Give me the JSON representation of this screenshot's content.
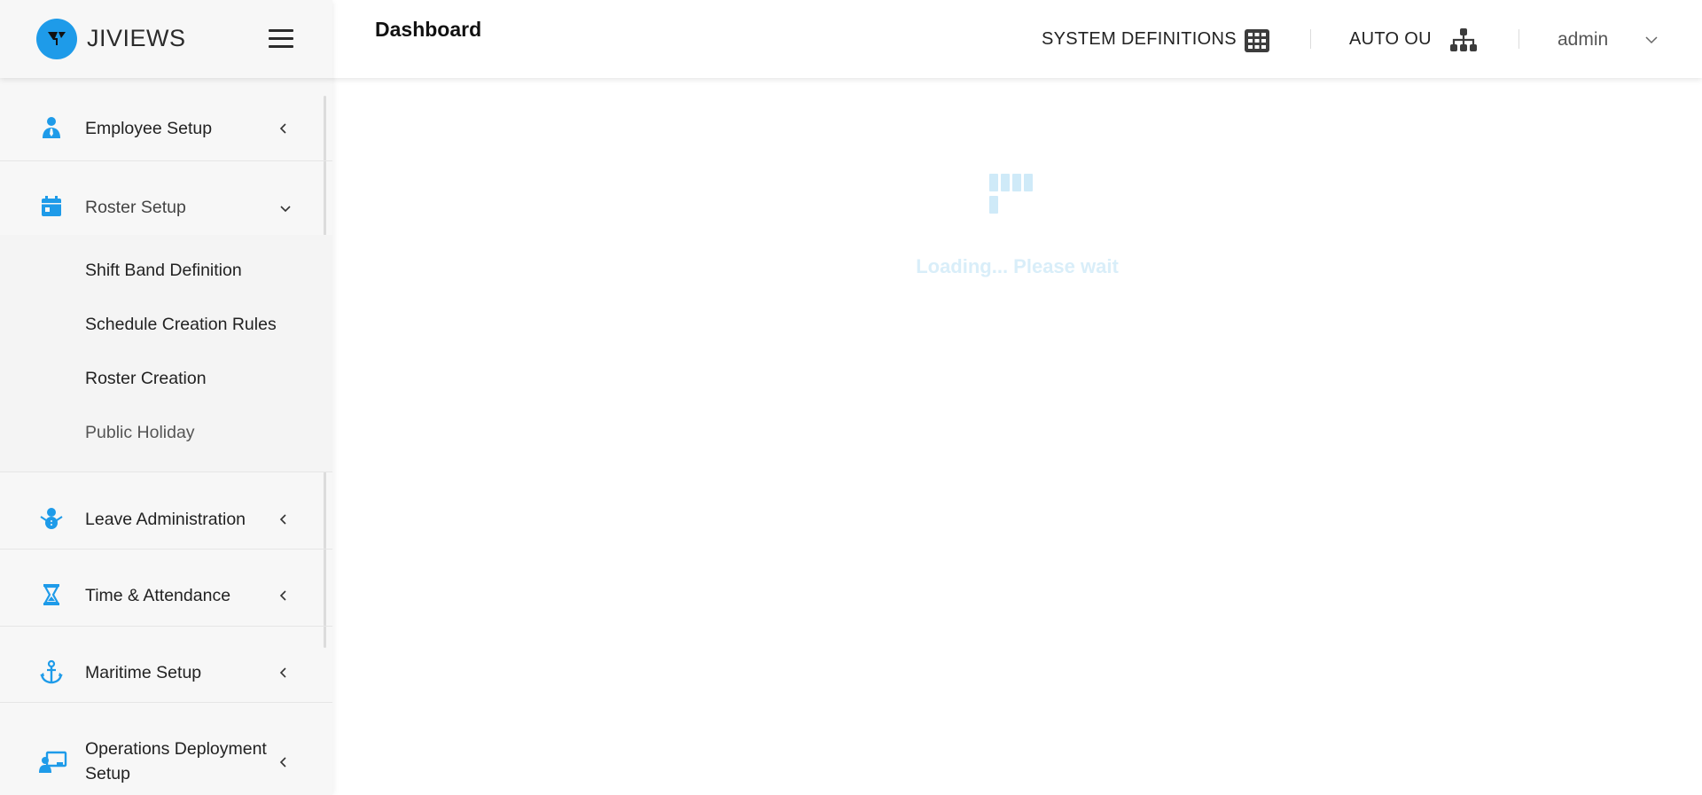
{
  "brand": {
    "name": "JIVIEWS",
    "logo_color": "#1e9be9"
  },
  "header": {
    "title": "Dashboard",
    "system_definitions_label": "SYSTEM DEFINITIONS",
    "auto_ou_label": "AUTO OU",
    "user_label": "admin"
  },
  "sidebar": {
    "accent_color": "#1e9be9",
    "items": [
      {
        "label": "Employee Setup",
        "icon": "employee-icon",
        "expanded": false
      },
      {
        "label": "Roster Setup",
        "icon": "calendar-icon",
        "expanded": true,
        "children": [
          {
            "label": "Shift Band Definition"
          },
          {
            "label": "Schedule Creation Rules"
          },
          {
            "label": "Roster Creation"
          },
          {
            "label": "Public Holiday"
          }
        ]
      },
      {
        "label": "Leave Administration",
        "icon": "snowman-icon",
        "expanded": false
      },
      {
        "label": "Time & Attendance",
        "icon": "hourglass-icon",
        "expanded": false
      },
      {
        "label": "Maritime Setup",
        "icon": "anchor-icon",
        "expanded": false
      },
      {
        "label": "Operations Deployment",
        "label_line2": "Setup",
        "icon": "chalkboard-user-icon",
        "expanded": false
      }
    ]
  },
  "main": {
    "loading_text": "Loading... Please wait"
  }
}
